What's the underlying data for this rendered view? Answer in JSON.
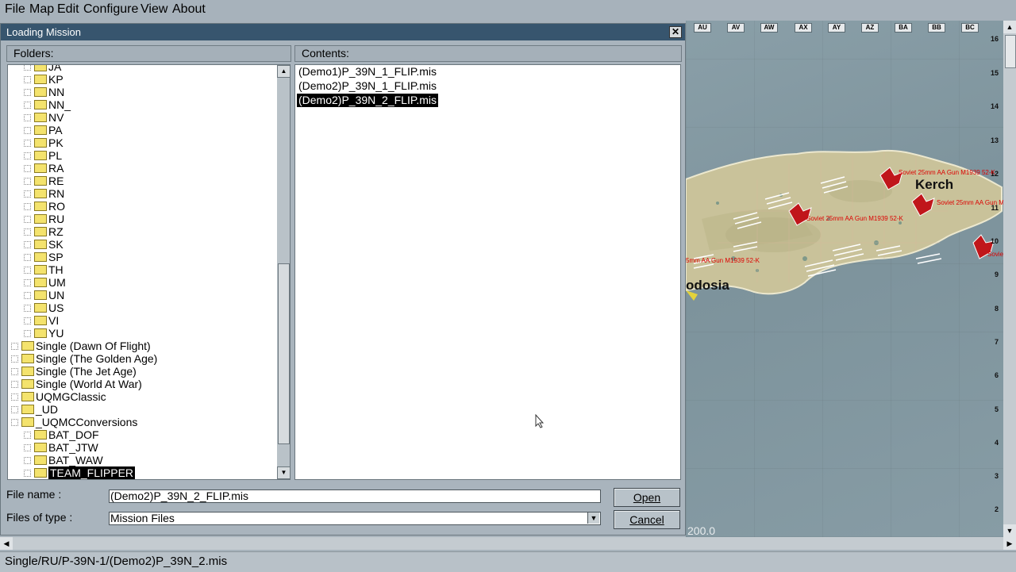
{
  "menu": [
    "File",
    "Map",
    "Edit",
    "Configure",
    "View",
    "About"
  ],
  "dialog": {
    "title": "Loading Mission",
    "close_glyph": "✕",
    "folders_header": "Folders:",
    "contents_header": "Contents:",
    "folders": [
      {
        "label": "JA",
        "level": 2
      },
      {
        "label": "KP",
        "level": 2
      },
      {
        "label": "NN",
        "level": 2
      },
      {
        "label": "NN_",
        "level": 2
      },
      {
        "label": "NV",
        "level": 2
      },
      {
        "label": "PA",
        "level": 2
      },
      {
        "label": "PK",
        "level": 2
      },
      {
        "label": "PL",
        "level": 2
      },
      {
        "label": "RA",
        "level": 2
      },
      {
        "label": "RE",
        "level": 2
      },
      {
        "label": "RN",
        "level": 2
      },
      {
        "label": "RO",
        "level": 2
      },
      {
        "label": "RU",
        "level": 2
      },
      {
        "label": "RZ",
        "level": 2
      },
      {
        "label": "SK",
        "level": 2
      },
      {
        "label": "SP",
        "level": 2
      },
      {
        "label": "TH",
        "level": 2
      },
      {
        "label": "UM",
        "level": 2
      },
      {
        "label": "UN",
        "level": 2
      },
      {
        "label": "US",
        "level": 2
      },
      {
        "label": "VI",
        "level": 2
      },
      {
        "label": "YU",
        "level": 2
      },
      {
        "label": "Single (Dawn Of Flight)",
        "level": 1
      },
      {
        "label": "Single (The Golden Age)",
        "level": 1
      },
      {
        "label": "Single (The Jet Age)",
        "level": 1
      },
      {
        "label": "Single (World At War)",
        "level": 1
      },
      {
        "label": "UQMGClassic",
        "level": 1
      },
      {
        "label": "_UD",
        "level": 1
      },
      {
        "label": "_UQMCConversions",
        "level": 1
      },
      {
        "label": "BAT_DOF",
        "level": 2
      },
      {
        "label": "BAT_JTW",
        "level": 2
      },
      {
        "label": "BAT_WAW",
        "level": 2
      },
      {
        "label": "TEAM_FLIPPER",
        "level": 2,
        "selected": true
      }
    ],
    "contents": [
      {
        "label": "(Demo1)P_39N_1_FLIP.mis"
      },
      {
        "label": "(Demo2)P_39N_1_FLIP.mis"
      },
      {
        "label": "(Demo2)P_39N_2_FLIP.mis",
        "selected": true
      }
    ],
    "file_name_label": "File name :",
    "file_name_value": "(Demo2)P_39N_2_FLIP.mis",
    "file_type_label": "Files of type :",
    "file_type_value": "Mission Files",
    "open_label": "Open",
    "cancel_label": "Cancel"
  },
  "map": {
    "columns": [
      "AU",
      "AV",
      "AW",
      "AX",
      "AY",
      "AZ",
      "BA",
      "BB",
      "BC"
    ],
    "rows": [
      "16",
      "15",
      "14",
      "13",
      "12",
      "11",
      "10",
      "9",
      "8",
      "7",
      "6",
      "5",
      "4",
      "3",
      "2"
    ],
    "cities": [
      "Kerch",
      "odosia"
    ],
    "unit_labels": [
      "Soviet 25mm AA Gun M1939 52-K",
      "Soviet 25mm AA Gun M1939 52-K",
      "Soviet 25mm AA Gun M1939 52-K",
      "5mm AA Gun M1939 52-K",
      "Soviet"
    ],
    "scale_text": "200.0",
    "colors": {
      "land": "#c9c29a",
      "sea": "#84999f",
      "unit": "#c0161b"
    }
  },
  "status_text": "Single/RU/P-39N-1/(Demo2)P_39N_2.mis"
}
